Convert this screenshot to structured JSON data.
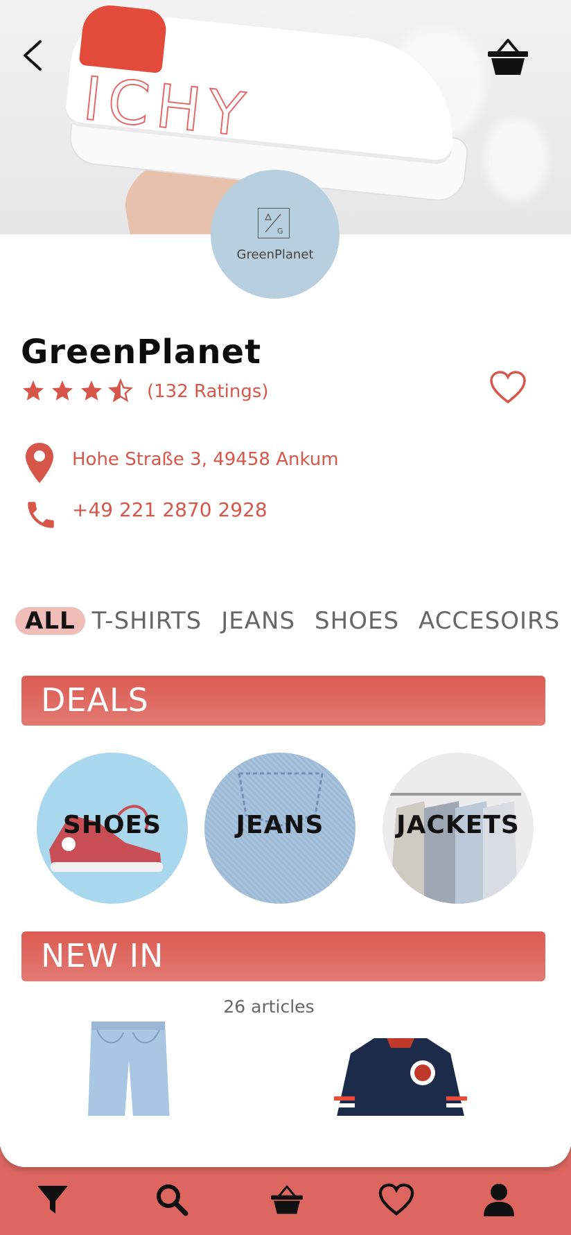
{
  "hero": {
    "back_icon": "chevron-left-icon",
    "basket_icon": "basket-icon",
    "shoe_print": "ICHY"
  },
  "logo": {
    "text": "GreenPlanet"
  },
  "shop": {
    "name": "GreenPlanet",
    "rating": 3.5,
    "ratings_label": "(132 Ratings)",
    "address": "Hohe Straße 3, 49458 Ankum",
    "phone": "+49 221 2870 2928"
  },
  "tabs": [
    {
      "label": "ALL"
    },
    {
      "label": "T-SHIRTS"
    },
    {
      "label": "JEANS"
    },
    {
      "label": "SHOES"
    },
    {
      "label": "ACCESOIRS"
    }
  ],
  "deals": {
    "title": "DEALS",
    "items": [
      {
        "label": "SHOES"
      },
      {
        "label": "JEANS"
      },
      {
        "label": "JACKETS"
      }
    ]
  },
  "new_in": {
    "title": "NEW IN",
    "count": "26 articles"
  },
  "colors": {
    "accent": "#d65749",
    "bar": "#dc5b52",
    "logo_bg": "#b8cfdf",
    "nav_bg": "#dd6760",
    "tab_active": "#f0bdb9"
  },
  "nav": {
    "items": [
      {
        "icon": "filter-icon"
      },
      {
        "icon": "search-icon"
      },
      {
        "icon": "basket-icon"
      },
      {
        "icon": "heart-icon"
      },
      {
        "icon": "user-icon"
      }
    ]
  }
}
